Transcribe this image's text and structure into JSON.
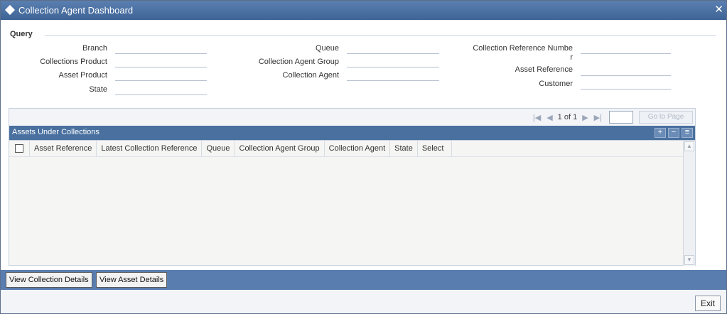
{
  "window": {
    "title": "Collection Agent Dashboard",
    "close_glyph": "✕"
  },
  "query": {
    "legend": "Query",
    "col1": {
      "branch": "Branch",
      "collections_product": "Collections Product",
      "asset_product": "Asset Product",
      "state": "State"
    },
    "col2": {
      "queue": "Queue",
      "collection_agent_group": "Collection Agent Group",
      "collection_agent": "Collection Agent"
    },
    "col3": {
      "collection_reference_line1": "Collection Reference Numbe",
      "collection_reference_line2": "r",
      "asset_reference": "Asset Reference",
      "customer": "Customer"
    }
  },
  "pager": {
    "first_icon": "first-page-icon",
    "prev_icon": "prev-page-icon",
    "text": "1 of 1",
    "next_icon": "next-page-icon",
    "last_icon": "last-page-icon",
    "goto_label": "Go to Page"
  },
  "grid": {
    "title": "Assets Under Collections",
    "columns": [
      "Asset Reference",
      "Latest Collection Reference",
      "Queue",
      "Collection Agent Group",
      "Collection Agent",
      "State",
      "Select"
    ],
    "rows": []
  },
  "actions": {
    "view_collection_details": "View Collection Details",
    "view_asset_details": "View Asset Details",
    "exit": "Exit"
  },
  "colors": {
    "titlebar": "#4a6fa0",
    "grid_header": "#49709f",
    "bottombar": "#5a7db0"
  }
}
